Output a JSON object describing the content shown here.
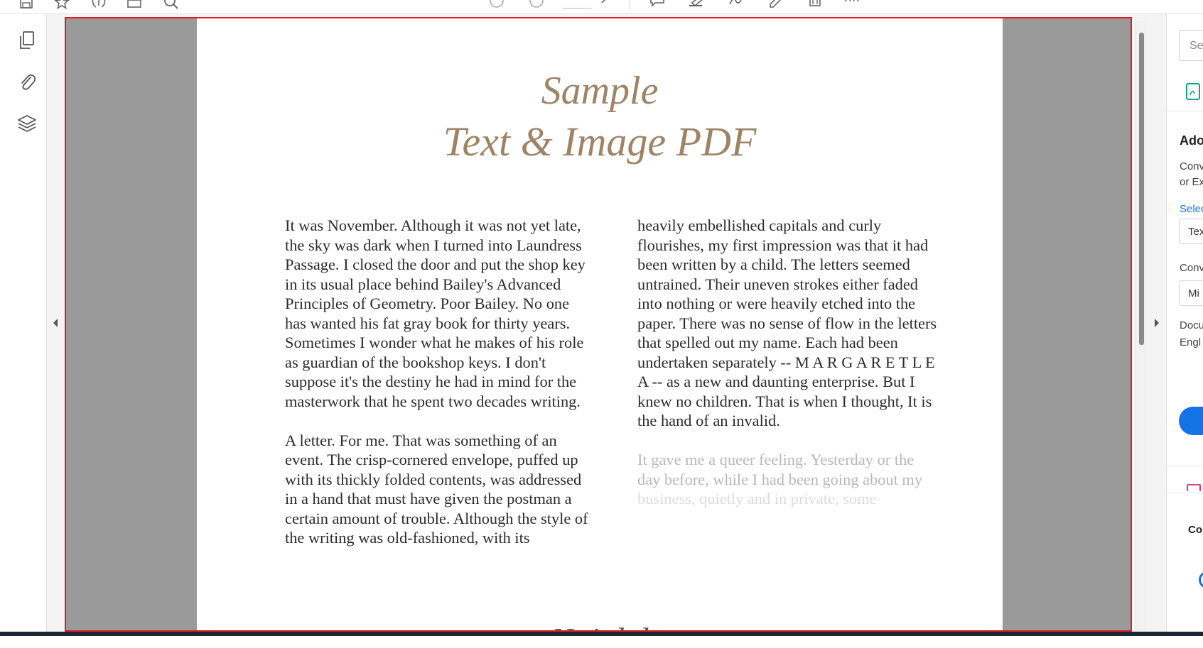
{
  "toolbar": {
    "icons": [
      "save-icon",
      "star-icon",
      "upload-icon",
      "print-icon",
      "search-icon",
      "page-up-icon",
      "page-down-icon",
      "comment-icon",
      "highlight-icon",
      "sign-icon",
      "edit-icon",
      "delete-icon",
      "fill-sign-icon"
    ]
  },
  "nav": {
    "icons": [
      "pages-icon",
      "attachment-icon",
      "layers-icon"
    ]
  },
  "document": {
    "title_line1": "Sample",
    "title_line2": "Text & Image PDF",
    "left_column": [
      "It was November. Although it was not yet late, the sky was dark when I turned into Laundress Passage. I closed the door and put the shop key in its usual place behind Bailey's Advanced Principles of Geometry. Poor Bailey. No one has wanted his fat gray book for thirty years. Sometimes I wonder what he makes of his role as guardian of the bookshop keys. I don't suppose it's the destiny he had in mind for the masterwork that he spent two decades writing.",
      "A letter. For me. That was something of an event. The crisp-cornered envelope, puffed up with its thickly folded contents, was addressed in a hand that must have given the postman a certain amount of trouble. Although the style of the writing was old-fashioned, with its"
    ],
    "right_column": [
      "heavily embellished capitals and curly flourishes, my first impression was that it had been written by a child. The letters seemed untrained. Their uneven strokes either faded into nothing or were heavily etched into the paper. There was no sense of flow in the letters that spelled out my name. Each had been undertaken separately -- M A R G A R E T L E A -- as a new and daunting enterprise. But I knew no children. That is when I thought, It is the hand of an invalid."
    ],
    "right_fading": {
      "line1": "It gave me a queer feeling. Yesterday or the",
      "line2": "day before, while I had been going about my",
      "line3": "business, quietly and in private, some"
    },
    "bottom_heading": "N                    ti        d        d"
  },
  "right_panel": {
    "search_placeholder": "Se",
    "heading": "Ado",
    "desc_line1": "Conv",
    "desc_line2": "or Ex",
    "select_link": "Selec",
    "select_value": "Tex",
    "convert_label": "Conv",
    "convert_value": "Mi",
    "doc_label": "Docu",
    "doc_value": "Engl",
    "section2_label": "Co"
  },
  "colors": {
    "title": "#9d8467",
    "selection_border": "#e01e25",
    "accent": "#1473e6",
    "viewport_bg": "#9a9a9a"
  }
}
